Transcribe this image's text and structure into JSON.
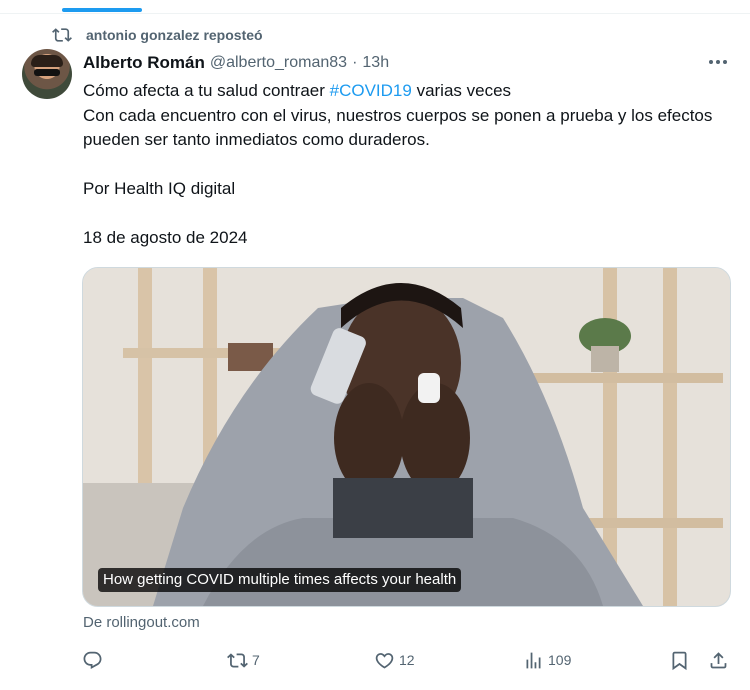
{
  "repost": {
    "label": "antonio gonzalez reposteó",
    "icon": "repost-icon"
  },
  "author": {
    "name": "Alberto Román",
    "handle": "@alberto_roman83",
    "separator": "·",
    "time": "13h"
  },
  "tweet": {
    "line1_prefix": "Cómo afecta a tu salud contraer ",
    "hashtag": "#COVID19",
    "line1_suffix": " varias veces",
    "line2": "Con cada encuentro con el virus, nuestros cuerpos se ponen a prueba y los efectos pueden ser tanto inmediatos como duraderos.",
    "line3": "Por Health IQ digital",
    "line4": "18 de agosto de 2024"
  },
  "card": {
    "caption": "How getting COVID multiple times affects your health",
    "source": "De rollingout.com"
  },
  "actions": {
    "reply": {
      "icon": "reply-icon",
      "count": ""
    },
    "repost": {
      "icon": "repost-icon",
      "count": "7"
    },
    "like": {
      "icon": "heart-icon",
      "count": "12"
    },
    "views": {
      "icon": "views-icon",
      "count": "109"
    },
    "bookmark": {
      "icon": "bookmark-icon"
    },
    "share": {
      "icon": "share-icon"
    }
  },
  "colors": {
    "accent": "#1d9bf0",
    "secondary_text": "#536471",
    "primary_text": "#0f1419"
  }
}
